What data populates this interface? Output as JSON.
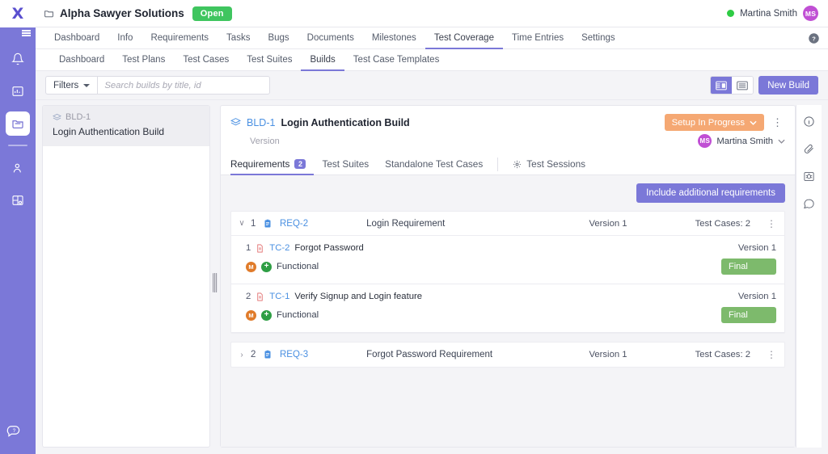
{
  "rail": {
    "logo": "X",
    "items": [
      {
        "name": "notifications-icon",
        "label": "Notifications"
      },
      {
        "name": "dashboard-icon",
        "label": "Dashboard"
      },
      {
        "name": "projects-icon",
        "label": "Projects",
        "active": true
      },
      {
        "name": "user-icon",
        "label": "Users"
      },
      {
        "name": "reports-icon",
        "label": "Reports"
      }
    ],
    "bottom": {
      "name": "support-icon",
      "label": "Support"
    }
  },
  "topbar": {
    "project_icon": "folder-icon",
    "project_name": "Alpha Sawyer Solutions",
    "status_pill": "Open",
    "user_name": "Martina Smith",
    "user_initials": "MS",
    "online": true
  },
  "nav": {
    "items": [
      {
        "label": "Dashboard"
      },
      {
        "label": "Info"
      },
      {
        "label": "Requirements"
      },
      {
        "label": "Tasks"
      },
      {
        "label": "Bugs"
      },
      {
        "label": "Documents"
      },
      {
        "label": "Milestones"
      },
      {
        "label": "Test Coverage",
        "active": true
      },
      {
        "label": "Time Entries"
      },
      {
        "label": "Settings"
      }
    ],
    "help_icon": "help-icon"
  },
  "subnav": {
    "items": [
      {
        "label": "Dashboard"
      },
      {
        "label": "Test Plans"
      },
      {
        "label": "Test Cases"
      },
      {
        "label": "Test Suites"
      },
      {
        "label": "Builds",
        "active": true
      },
      {
        "label": "Test Case Templates"
      }
    ]
  },
  "filterbar": {
    "filters_label": "Filters",
    "search_placeholder": "Search builds by title, id",
    "search_value": "",
    "view_split_icon": "split-view-icon",
    "view_list_icon": "list-view-icon",
    "new_build_label": "New Build"
  },
  "leftpane": {
    "build": {
      "id": "BLD-1",
      "title": "Login Authentication Build",
      "icon": "build-icon"
    }
  },
  "detail": {
    "id": "BLD-1",
    "title": "Login Authentication Build",
    "version_label": "Version",
    "status": "Setup In Progress",
    "owner_name": "Martina Smith",
    "owner_initials": "MS",
    "tabs": [
      {
        "label": "Requirements",
        "badge": "2",
        "active": true
      },
      {
        "label": "Test Suites"
      },
      {
        "label": "Standalone Test Cases"
      },
      {
        "label": "Test Sessions",
        "icon": "gear-icon"
      }
    ],
    "include_button": "Include additional requirements"
  },
  "requirements": [
    {
      "expanded": true,
      "chevron": "∨",
      "num": "1",
      "id": "REQ-2",
      "name": "Login Requirement",
      "version": "Version 1",
      "test_cases": "Test Cases: 2",
      "icon": "requirement-icon",
      "cases": [
        {
          "num": "1",
          "id": "TC-2",
          "name": "Forgot Password",
          "version": "Version 1",
          "priority": "M",
          "type": "Functional",
          "status": "Final"
        },
        {
          "num": "2",
          "id": "TC-1",
          "name": "Verify Signup and Login feature",
          "version": "Version 1",
          "priority": "M",
          "type": "Functional",
          "status": "Final"
        }
      ]
    },
    {
      "expanded": false,
      "chevron": "›",
      "num": "2",
      "id": "REQ-3",
      "name": "Forgot Password Requirement",
      "version": "Version 1",
      "test_cases": "Test Cases: 2",
      "icon": "requirement-icon",
      "cases": []
    }
  ],
  "iconrail": {
    "items": [
      {
        "name": "info-icon"
      },
      {
        "name": "attachment-icon"
      },
      {
        "name": "bug-icon",
        "active": true
      },
      {
        "name": "comment-icon"
      }
    ]
  },
  "colors": {
    "brand": "#7b78d8",
    "open_green": "#3fc55f",
    "status_orange": "#f5a873",
    "final_green": "#7dba6c",
    "link_blue": "#4a90e2",
    "priority_orange": "#e07b2a",
    "type_green": "#2e9e44",
    "avatar_purple": "#c04fd4"
  }
}
